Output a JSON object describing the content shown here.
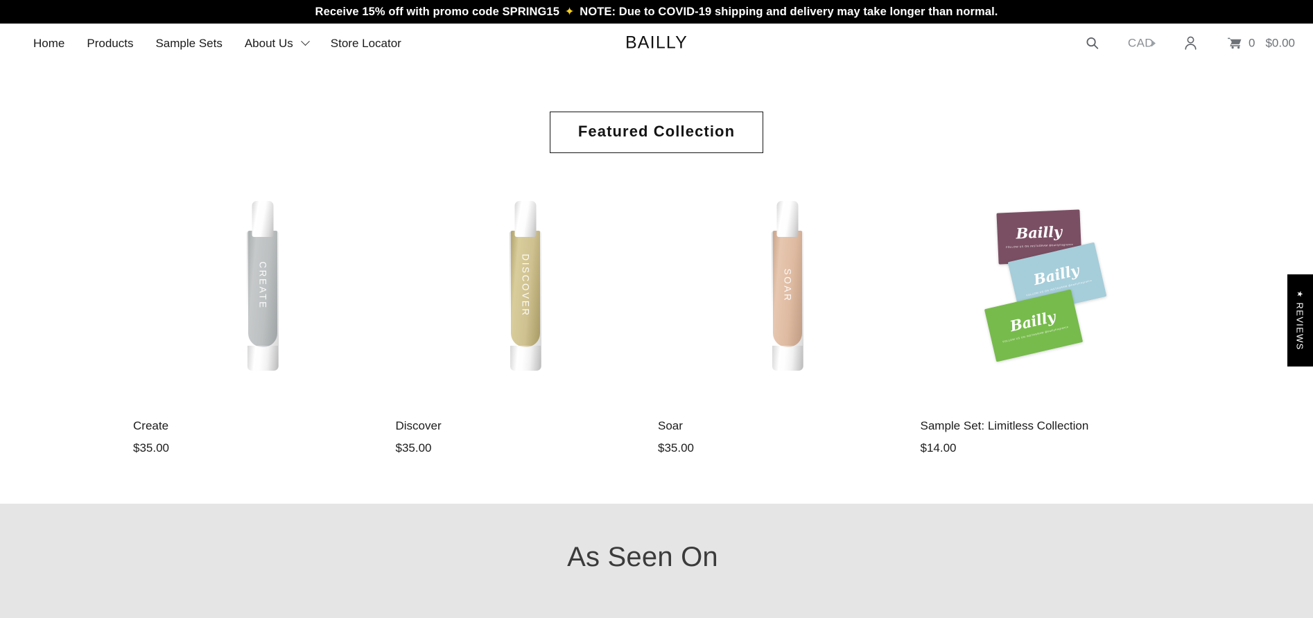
{
  "announcement": {
    "text_before": "Receive 15% off with promo code SPRING15",
    "sparkle": "✦",
    "text_after": "NOTE: Due to COVID-19 shipping and delivery may take longer than normal.",
    "background": "#000000",
    "color": "#ffffff"
  },
  "header": {
    "logo": "BAILLY",
    "nav": [
      {
        "label": "Home",
        "has_caret": false
      },
      {
        "label": "Products",
        "has_caret": false
      },
      {
        "label": "Sample Sets",
        "has_caret": false
      },
      {
        "label": "About Us",
        "has_caret": true
      },
      {
        "label": "Store Locator",
        "has_caret": false
      }
    ],
    "search_icon": "search-icon",
    "currency": "CAD",
    "account_icon": "account-icon",
    "cart": {
      "icon": "cart-icon",
      "count": "0",
      "total": "$0.00"
    }
  },
  "featured": {
    "heading": "Featured Collection",
    "products": [
      {
        "title": "Create",
        "price": "$35.00",
        "bottle_label": "CREATE",
        "fluid_color": "#b9bcbd",
        "fluid_color_alt": "#9fa4a6"
      },
      {
        "title": "Discover",
        "price": "$35.00",
        "bottle_label": "DISCOVER",
        "fluid_color": "#d0c490",
        "fluid_color_alt": "#b6a871"
      },
      {
        "title": "Soar",
        "price": "$35.00",
        "bottle_label": "SOAR",
        "fluid_color": "#e0bda5",
        "fluid_color_alt": "#cda68d"
      },
      {
        "title": "Sample Set: Limitless Collection",
        "price": "$14.00",
        "bottle_label": "",
        "fluid_color": "",
        "fluid_color_alt": ""
      }
    ]
  },
  "sample_cards": [
    {
      "name": "Bailly",
      "sub": "FOLLOW US ON INSTAGRAM @baillyfragrance",
      "color": "#7b4f63"
    },
    {
      "name": "Bailly",
      "sub": "FOLLOW US ON INSTAGRAM @baillyfragrance",
      "color": "#a6cdda"
    },
    {
      "name": "Bailly",
      "sub": "FOLLOW US ON INSTAGRAM @baillyfragrance",
      "color": "#77bb4c"
    }
  ],
  "as_seen_on": {
    "title": "As Seen On",
    "background": "#e5e5e5"
  },
  "reviews_tab": {
    "star": "★",
    "label": "REVIEWS"
  }
}
